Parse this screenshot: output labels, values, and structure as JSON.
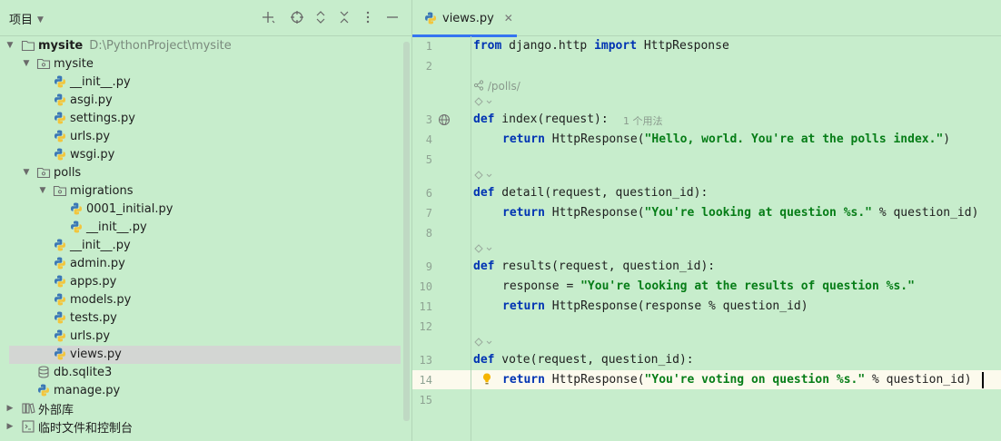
{
  "project_panel": {
    "title": "项目",
    "header_icons": [
      "add-icon",
      "locate-icon",
      "expand-all-icon",
      "collapse-all-icon",
      "more-options-icon",
      "hide-icon"
    ],
    "tree": [
      {
        "label": "mysite",
        "hint": "D:\\PythonProject\\mysite",
        "type": "root-folder",
        "bold": true
      },
      {
        "label": "mysite",
        "type": "package"
      },
      {
        "label": "__init__.py",
        "type": "python-file"
      },
      {
        "label": "asgi.py",
        "type": "python-file"
      },
      {
        "label": "settings.py",
        "type": "python-file"
      },
      {
        "label": "urls.py",
        "type": "python-file"
      },
      {
        "label": "wsgi.py",
        "type": "python-file"
      },
      {
        "label": "polls",
        "type": "package"
      },
      {
        "label": "migrations",
        "type": "package"
      },
      {
        "label": "0001_initial.py",
        "type": "python-file"
      },
      {
        "label": "__init__.py",
        "type": "python-file"
      },
      {
        "label": "__init__.py",
        "type": "python-file"
      },
      {
        "label": "admin.py",
        "type": "python-file"
      },
      {
        "label": "apps.py",
        "type": "python-file"
      },
      {
        "label": "models.py",
        "type": "python-file"
      },
      {
        "label": "tests.py",
        "type": "python-file"
      },
      {
        "label": "urls.py",
        "type": "python-file"
      },
      {
        "label": "views.py",
        "type": "python-file",
        "selected": true
      },
      {
        "label": "db.sqlite3",
        "type": "database-file"
      },
      {
        "label": "manage.py",
        "type": "python-file"
      },
      {
        "label": "外部库",
        "type": "library"
      },
      {
        "label": "临时文件和控制台",
        "type": "scratches"
      }
    ]
  },
  "editor": {
    "tab": {
      "label": "views.py",
      "close": "✕"
    },
    "line_numbers": [
      "1",
      "2",
      "3",
      "4",
      "5",
      "6",
      "7",
      "8",
      "9",
      "10",
      "11",
      "12",
      "13",
      "14",
      "15"
    ],
    "inlays": {
      "route": "/polls/",
      "usages": "1 个用法"
    },
    "code": {
      "l1_kw1": "from",
      "l1_mod": " django.http ",
      "l1_kw2": "import",
      "l1_name": " HttpResponse",
      "l3_kw": "def",
      "l3_sig": " index(request):",
      "l4_kw": "return",
      "l4_call": " HttpResponse(",
      "l4_str": "\"Hello, world. You're at the polls index.\"",
      "l4_end": ")",
      "l6_kw": "def",
      "l6_sig": " detail(request, question_id):",
      "l7_kw": "return",
      "l7_call": " HttpResponse(",
      "l7_str": "\"You're looking at question %s.\"",
      "l7_end": " % question_id)",
      "l9_kw": "def",
      "l9_sig": " results(request, question_id):",
      "l10_var": "response = ",
      "l10_str": "\"You're looking at the results of question %s.\"",
      "l11_kw": "return",
      "l11_call": " HttpResponse(response % question_id)",
      "l13_kw": "def",
      "l13_sig": " vote(request, question_id):",
      "l14_kw": "return",
      "l14_call": " HttpResponse(",
      "l14_str": "\"You're voting on question %s.\"",
      "l14_end": " % question_id)"
    }
  },
  "colors": {
    "background": "#c7edcc",
    "keyword": "#0033b3",
    "string": "#067d17",
    "selection": "#d3d6d3",
    "tab_underline": "#3574f0"
  }
}
